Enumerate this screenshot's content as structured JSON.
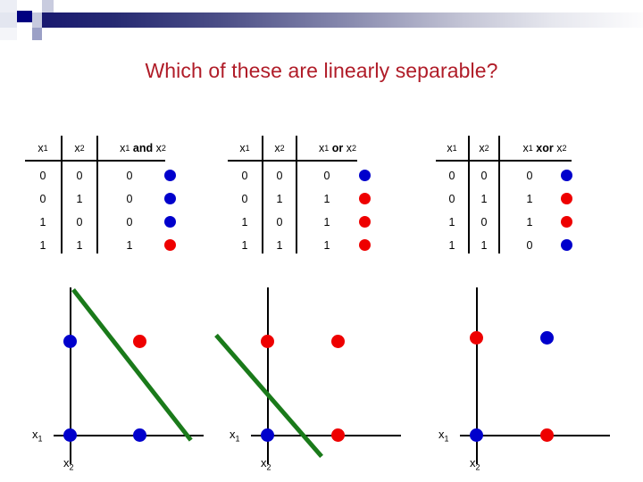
{
  "slide": {
    "title": "Which of these are linearly separable?",
    "title_color": "#b01c28"
  },
  "colors": {
    "class_blue": "#0000cc",
    "class_red": "#ee0000",
    "separator_green": "#1a7a1a",
    "band_navy": "#191970"
  },
  "tables": [
    {
      "id": "and",
      "headers": [
        "x1",
        "x2",
        "x1 and x2"
      ],
      "header_parts": {
        "c1": "x",
        "c1s": "1",
        "c2": "x",
        "c2s": "2",
        "r_left": "x",
        "r_left_sub": "1",
        "r_op": "and",
        "r_right": "x",
        "r_right_sub": "2"
      },
      "rows": [
        {
          "x1": "0",
          "x2": "0",
          "out": "0",
          "dot": "blue"
        },
        {
          "x1": "0",
          "x2": "1",
          "out": "0",
          "dot": "blue"
        },
        {
          "x1": "1",
          "x2": "0",
          "out": "0",
          "dot": "blue"
        },
        {
          "x1": "1",
          "x2": "1",
          "out": "1",
          "dot": "red"
        }
      ]
    },
    {
      "id": "or",
      "headers": [
        "x1",
        "x2",
        "x1 or x2"
      ],
      "header_parts": {
        "c1": "x",
        "c1s": "1",
        "c2": "x",
        "c2s": "2",
        "r_left": "x",
        "r_left_sub": "1",
        "r_op": "or",
        "r_right": "x",
        "r_right_sub": "2"
      },
      "rows": [
        {
          "x1": "0",
          "x2": "0",
          "out": "0",
          "dot": "blue"
        },
        {
          "x1": "0",
          "x2": "1",
          "out": "1",
          "dot": "red"
        },
        {
          "x1": "1",
          "x2": "0",
          "out": "1",
          "dot": "red"
        },
        {
          "x1": "1",
          "x2": "1",
          "out": "1",
          "dot": "red"
        }
      ]
    },
    {
      "id": "xor",
      "headers": [
        "x1",
        "x2",
        "x1 xor x2"
      ],
      "header_parts": {
        "c1": "x",
        "c1s": "1",
        "c2": "x",
        "c2s": "2",
        "r_left": "x",
        "r_left_sub": "1",
        "r_op": "xor",
        "r_right": "x",
        "r_right_sub": "2"
      },
      "rows": [
        {
          "x1": "0",
          "x2": "0",
          "out": "0",
          "dot": "blue"
        },
        {
          "x1": "0",
          "x2": "1",
          "out": "1",
          "dot": "red"
        },
        {
          "x1": "1",
          "x2": "0",
          "out": "1",
          "dot": "red"
        },
        {
          "x1": "1",
          "x2": "1",
          "out": "0",
          "dot": "blue"
        }
      ]
    }
  ],
  "plots": [
    {
      "id": "and",
      "xlabel": "x",
      "xlabel_sub": "1",
      "ylabel": "x",
      "ylabel_sub": "2",
      "points": [
        {
          "x": 0,
          "y": 0,
          "class": "blue"
        },
        {
          "x": 0,
          "y": 1,
          "class": "blue"
        },
        {
          "x": 1,
          "y": 0,
          "class": "blue"
        },
        {
          "x": 1,
          "y": 1,
          "class": "red"
        }
      ],
      "separator": true
    },
    {
      "id": "or",
      "xlabel": "x",
      "xlabel_sub": "1",
      "ylabel": "x",
      "ylabel_sub": "2",
      "points": [
        {
          "x": 0,
          "y": 0,
          "class": "blue"
        },
        {
          "x": 0,
          "y": 1,
          "class": "red"
        },
        {
          "x": 1,
          "y": 0,
          "class": "red"
        },
        {
          "x": 1,
          "y": 1,
          "class": "red"
        }
      ],
      "separator": true
    },
    {
      "id": "xor",
      "xlabel": "x",
      "xlabel_sub": "1",
      "ylabel": "x",
      "ylabel_sub": "2",
      "points": [
        {
          "x": 0,
          "y": 0,
          "class": "blue"
        },
        {
          "x": 0,
          "y": 1,
          "class": "red"
        },
        {
          "x": 1,
          "y": 0,
          "class": "red"
        },
        {
          "x": 1,
          "y": 1,
          "class": "blue"
        }
      ],
      "separator": false
    }
  ]
}
